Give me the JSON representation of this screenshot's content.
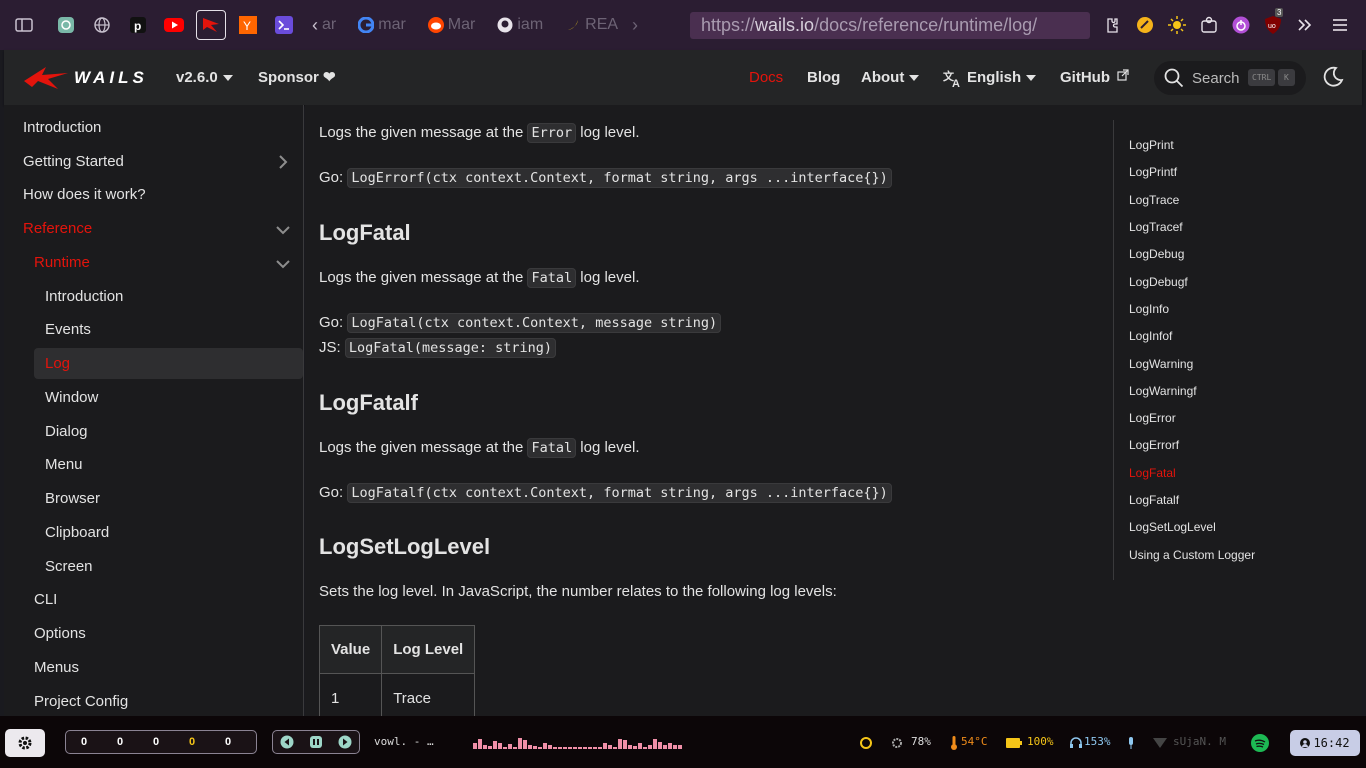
{
  "browser": {
    "url_prefix": "https://",
    "url_host": "wails.io",
    "url_path": "/docs/reference/runtime/log/",
    "tabs": [
      {
        "label": "ar",
        "icon": "back-chevron-icon"
      },
      {
        "label": "mar",
        "icon": "google-icon"
      },
      {
        "label": "Mar",
        "icon": "reddit-icon"
      },
      {
        "label": "iam",
        "icon": "github-icon"
      },
      {
        "label": "REA",
        "icon": "banana-icon"
      }
    ],
    "extension_badge": "3"
  },
  "site": {
    "brand": "WAILS",
    "version": "v2.6.0",
    "sponsor": "Sponsor ❤",
    "nav": {
      "docs": "Docs",
      "blog": "Blog",
      "about": "About",
      "language": "English",
      "github": "GitHub"
    },
    "search_placeholder": "Search",
    "kbd_ctrl": "CTRL",
    "kbd_k": "K"
  },
  "sidebar": {
    "items": [
      {
        "label": "Introduction"
      },
      {
        "label": "Getting Started"
      },
      {
        "label": "How does it work?"
      },
      {
        "label": "Reference"
      },
      {
        "label": "Runtime"
      },
      {
        "label": "Introduction"
      },
      {
        "label": "Events"
      },
      {
        "label": "Log"
      },
      {
        "label": "Window"
      },
      {
        "label": "Dialog"
      },
      {
        "label": "Menu"
      },
      {
        "label": "Browser"
      },
      {
        "label": "Clipboard"
      },
      {
        "label": "Screen"
      },
      {
        "label": "CLI"
      },
      {
        "label": "Options"
      },
      {
        "label": "Menus"
      },
      {
        "label": "Project Config"
      }
    ]
  },
  "content": {
    "error_desc_pre": "Logs the given message at the ",
    "error_code": "Error",
    "desc_post": " log level.",
    "go_label": "Go: ",
    "js_label": "JS: ",
    "logerrorf_go": "LogErrorf(ctx context.Context, format string, args ...interface{})",
    "logfatal_heading": "LogFatal",
    "fatal_desc_pre": "Logs the given message at the ",
    "fatal_code": "Fatal",
    "logfatal_go": "LogFatal(ctx context.Context, message string)",
    "logfatal_js": "LogFatal(message: string)",
    "logfatalf_heading": "LogFatalf",
    "logfatalf_go": "LogFatalf(ctx context.Context, format string, args ...interface{})",
    "logsetloglevel_heading": "LogSetLogLevel",
    "logsetloglevel_desc": "Sets the log level. In JavaScript, the number relates to the following log levels:",
    "table": {
      "headers": [
        "Value",
        "Log Level"
      ],
      "rows": [
        [
          "1",
          "Trace"
        ]
      ]
    }
  },
  "toc": {
    "items": [
      "LogPrint",
      "LogPrintf",
      "LogTrace",
      "LogTracef",
      "LogDebug",
      "LogDebugf",
      "LogInfo",
      "LogInfof",
      "LogWarning",
      "LogWarningf",
      "LogError",
      "LogErrorf",
      "LogFatal",
      "LogFatalf",
      "LogSetLogLevel",
      "Using a Custom Logger"
    ],
    "active": "LogFatal"
  },
  "taskbar": {
    "workspaces": [
      "0",
      "0",
      "0",
      "0",
      "0"
    ],
    "window_title": "vowl. - …",
    "cpu": "78%",
    "temp": "54°C",
    "battery": "100%",
    "volume": "153%",
    "network": "sUjaN. M",
    "clock": "16:42",
    "accent": "#e3140c"
  }
}
